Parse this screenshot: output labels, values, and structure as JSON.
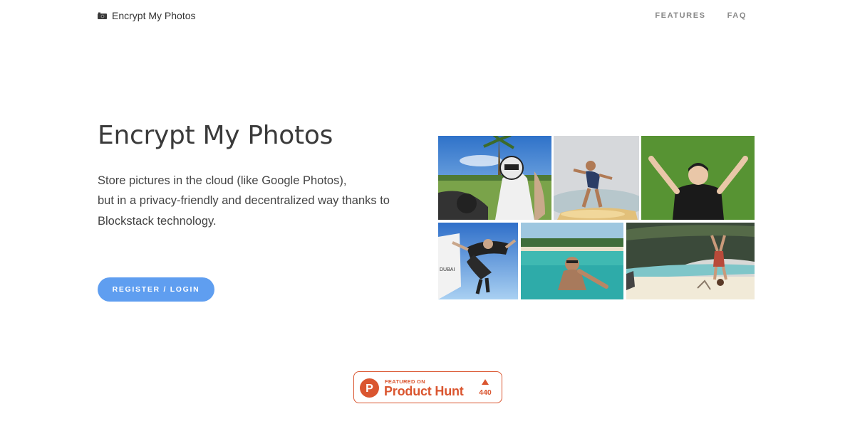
{
  "nav": {
    "brand": "Encrypt My Photos",
    "links": [
      "FEATURES",
      "FAQ"
    ]
  },
  "hero": {
    "title": "Encrypt My Photos",
    "description_lines": [
      "Store pictures in the cloud (like Google Photos),",
      "but in a privacy-friendly and decentralized way thanks to",
      "Blockstack technology."
    ],
    "cta_label": "REGISTER / LOGIN",
    "cta_color": "#5f9ef0"
  },
  "collage": {
    "photos": [
      "motorbike-selfie-photo",
      "surfing-photo",
      "lying-on-grass-photo",
      "skydiving-photo",
      "swimming-selfie-photo",
      "beach-handstand-photo"
    ]
  },
  "product_hunt": {
    "featured_on": "FEATURED ON",
    "name": "Product Hunt",
    "votes": "440",
    "logo_letter": "P",
    "color": "#da552f"
  }
}
